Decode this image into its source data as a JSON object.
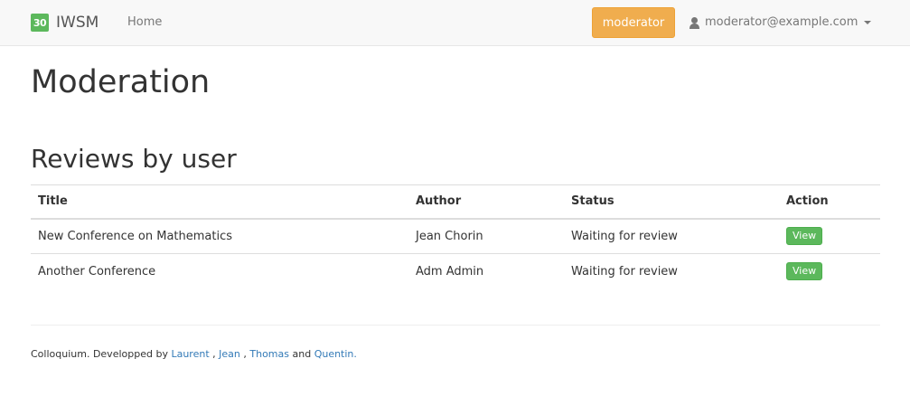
{
  "navbar": {
    "logo_text": "30",
    "brand": "IWSM",
    "home_label": "Home",
    "role_badge": "moderator",
    "user_email": "moderator@example.com",
    "user_icon": "user-icon",
    "caret_icon": "caret-down-icon"
  },
  "page": {
    "title": "Moderation",
    "section_title": "Reviews by user"
  },
  "table": {
    "headers": [
      "Title",
      "Author",
      "Status",
      "Action"
    ],
    "rows": [
      {
        "title": "New Conference on Mathematics",
        "author": "Jean Chorin",
        "status": "Waiting for review",
        "action": "View"
      },
      {
        "title": "Another Conference",
        "author": "Adm Admin",
        "status": "Waiting for review",
        "action": "View"
      }
    ]
  },
  "footer": {
    "prefix": "Colloquium. Developped by ",
    "authors": [
      "Laurent",
      "Jean",
      "Thomas",
      "Quentin."
    ],
    "sep1": " , ",
    "sep2": " , ",
    "sep3": " and "
  },
  "colors": {
    "accent_warning": "#f0ad4e",
    "accent_success": "#5cb85c",
    "link": "#337ab7"
  }
}
